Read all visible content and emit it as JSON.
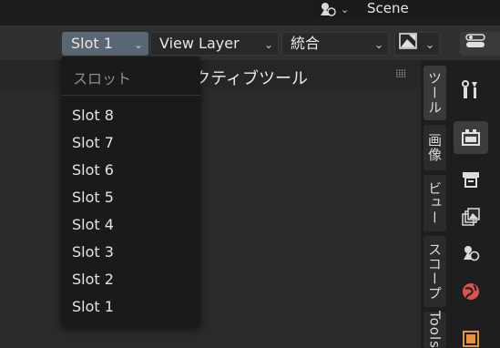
{
  "topbar": {
    "scene_label": "Scene",
    "scene_icon": "scene-data-icon"
  },
  "header": {
    "slot_dropdown": "Slot 1",
    "view_layer_dropdown": "View Layer",
    "pass_dropdown": "統合",
    "image_menu_icon": "image-icon",
    "right_menu_icon": "toggle-panel-icon"
  },
  "toolbar": {
    "title": "アクティブツール"
  },
  "slot_menu": {
    "title": "スロット",
    "items": [
      "Slot 8",
      "Slot 7",
      "Slot 6",
      "Slot 5",
      "Slot 4",
      "Slot 3",
      "Slot 2",
      "Slot 1"
    ]
  },
  "vertical_tabs": [
    {
      "label": "ツール"
    },
    {
      "label": "画像"
    },
    {
      "label": "ビュー"
    },
    {
      "label": "スコープ"
    },
    {
      "label": "Tools"
    }
  ],
  "properties_icons": [
    "tool-icon",
    "render-icon",
    "output-icon",
    "view-layer-icon",
    "scene-icon",
    "world-icon",
    "object-icon"
  ],
  "colors": {
    "accent_active_dropdown": "#5a6672",
    "background": "#2b2b2b",
    "menu_bg": "#1a1a1a",
    "world_icon_red": "#d9534f",
    "object_icon_orange": "#e8933b"
  }
}
